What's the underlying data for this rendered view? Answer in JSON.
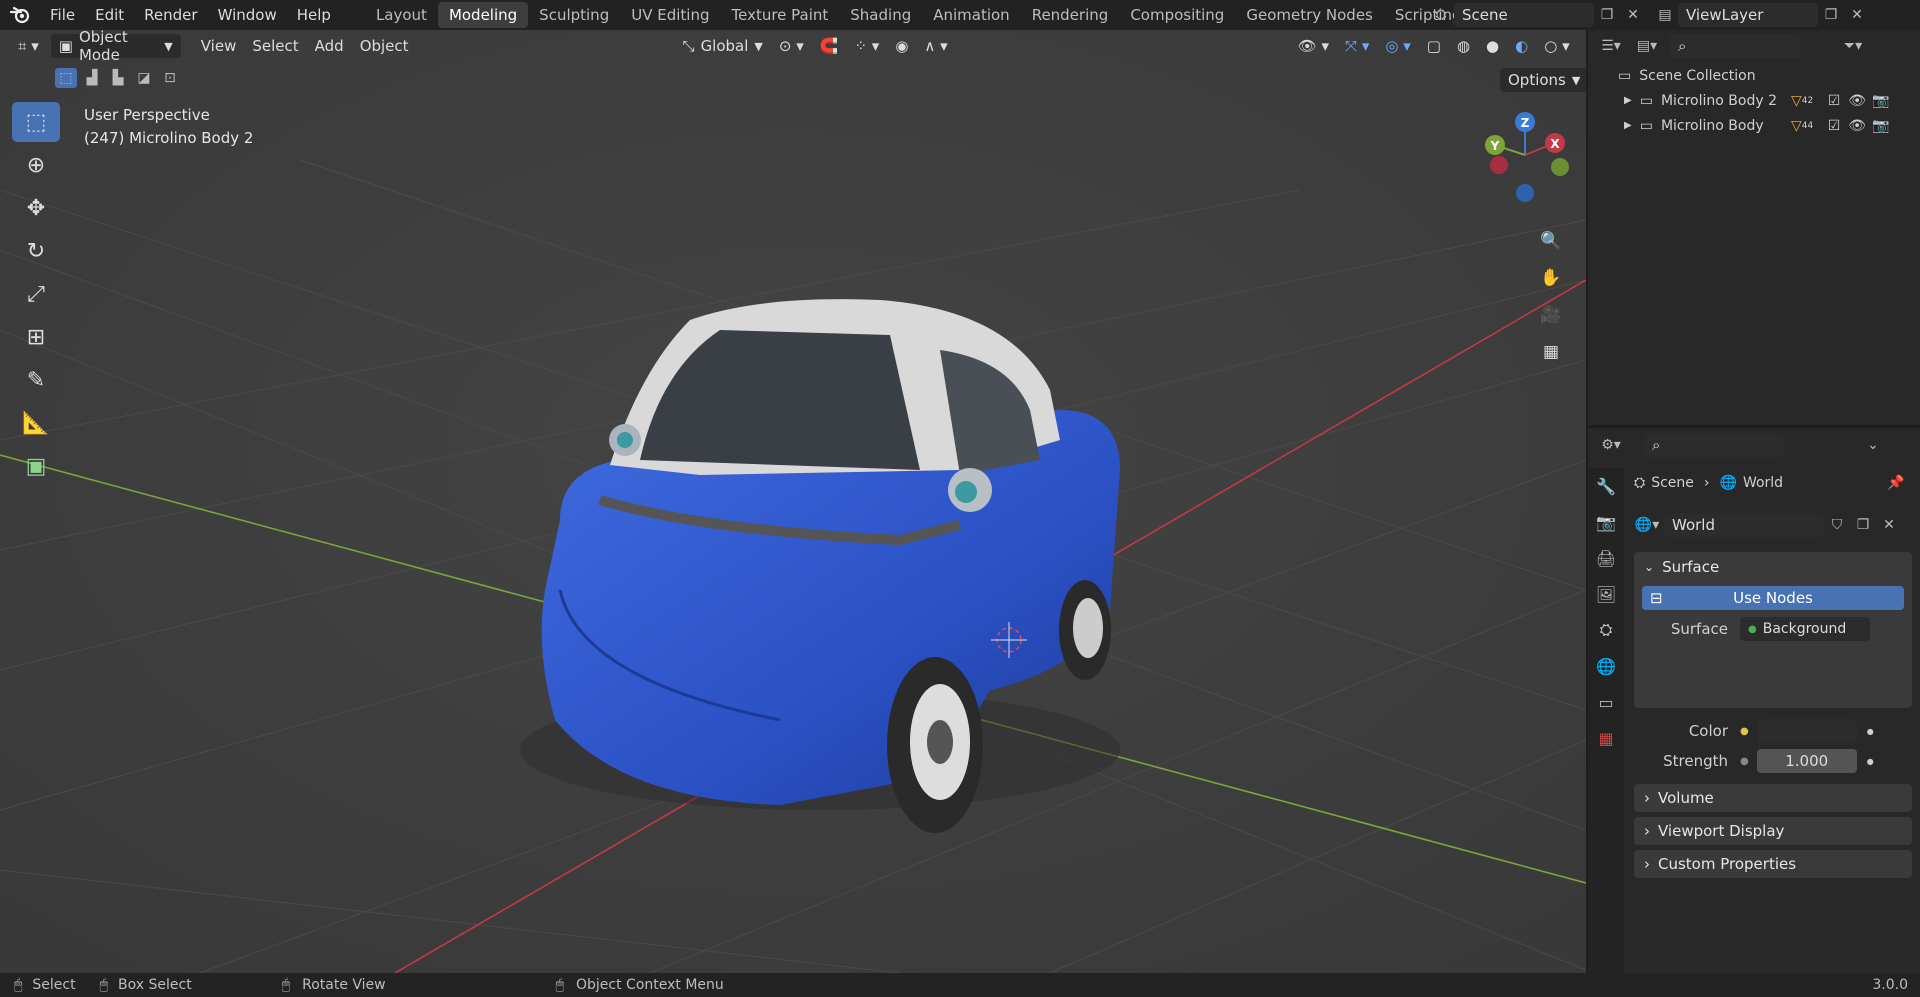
{
  "menubar": {
    "items": [
      "File",
      "Edit",
      "Render",
      "Window",
      "Help"
    ],
    "workspaces": [
      "Layout",
      "Modeling",
      "Sculpting",
      "UV Editing",
      "Texture Paint",
      "Shading",
      "Animation",
      "Rendering",
      "Compositing",
      "Geometry Nodes",
      "Scripting"
    ],
    "active_workspace": "Modeling",
    "scene": "Scene",
    "view_layer": "ViewLayer"
  },
  "viewport": {
    "mode": "Object Mode",
    "menus": [
      "View",
      "Select",
      "Add",
      "Object"
    ],
    "orientation": "Global",
    "options": "Options",
    "perspective": "User Perspective",
    "active_object": "(247) Microlino Body 2",
    "gizmo_axes": [
      "Z",
      "Y",
      "X"
    ],
    "colors": {
      "body": "#2d56c9",
      "background": "#3c3c3c",
      "x_axis": "#c2394a",
      "y_axis": "#7da43a",
      "z_axis": "#3a7bd5"
    }
  },
  "outliner": {
    "root": "Scene Collection",
    "items": [
      {
        "name": "Microlino Body 2",
        "count": "42"
      },
      {
        "name": "Microlino Body",
        "count": "44"
      }
    ]
  },
  "properties": {
    "breadcrumb": [
      "Scene",
      "World"
    ],
    "world_name": "World",
    "surface_panel": "Surface",
    "use_nodes": "Use Nodes",
    "surface_label": "Surface",
    "surface_value": "Background",
    "color_label": "Color",
    "strength_label": "Strength",
    "strength_value": "1.000",
    "collapsed_panels": [
      "Volume",
      "Viewport Display",
      "Custom Properties"
    ]
  },
  "statusbar": {
    "select": "Select",
    "box_select": "Box Select",
    "rotate_view": "Rotate View",
    "context_menu": "Object Context Menu",
    "version": "3.0.0"
  }
}
